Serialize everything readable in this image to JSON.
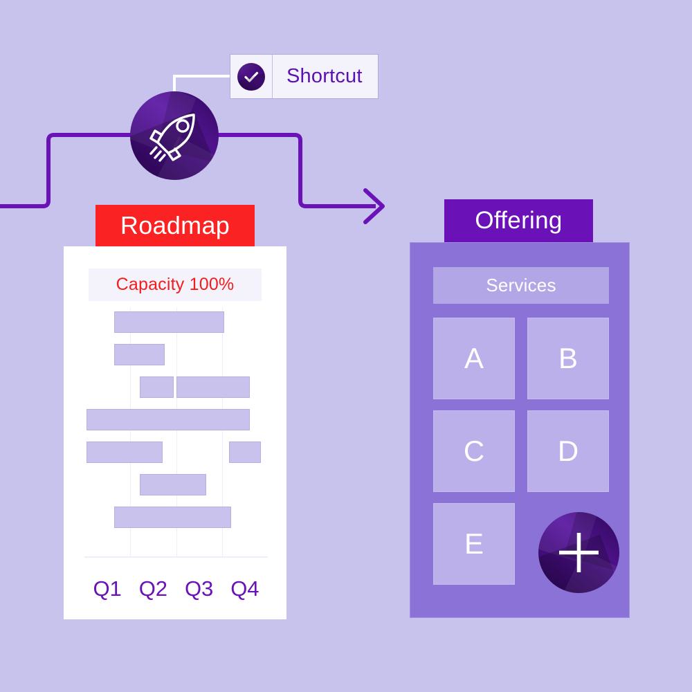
{
  "theme": {
    "background": "#c8c3ec",
    "accent_purple": "#6a11b8",
    "accent_red": "#fa2222",
    "offering_panel": "#8a72d6",
    "tile_fill": "#bcb0ea",
    "bar_fill": "#c9c2ec",
    "wire_color": "#6a11b8",
    "shortcut_wire_color": "#ffffff"
  },
  "shortcut": {
    "label": "Shortcut",
    "icon": "check-circle-icon"
  },
  "rocket_badge": {
    "icon": "rocket-icon"
  },
  "flow": {
    "arrow_icon": "arrow-right-icon"
  },
  "roadmap": {
    "title": "Roadmap",
    "capacity_label": "Capacity 100%",
    "quarters": [
      "Q1",
      "Q2",
      "Q3",
      "Q4"
    ],
    "chart_data": {
      "type": "bar",
      "title": "Roadmap",
      "xlabel": "",
      "ylabel": "",
      "grid": true,
      "legend": "none",
      "categories": [
        "Q1",
        "Q2",
        "Q3",
        "Q4"
      ],
      "xlim": [
        0,
        4
      ],
      "tasks": [
        {
          "row": 1,
          "start": 0.65,
          "end": 3.05
        },
        {
          "row": 2,
          "start": 0.65,
          "end": 1.75
        },
        {
          "row": 3,
          "start": 1.2,
          "end": 1.95
        },
        {
          "row": 3,
          "start": 2.0,
          "end": 3.6
        },
        {
          "row": 4,
          "start": 0.05,
          "end": 3.6
        },
        {
          "row": 5,
          "start": 0.05,
          "end": 1.7
        },
        {
          "row": 5,
          "start": 3.15,
          "end": 3.85
        },
        {
          "row": 6,
          "start": 1.2,
          "end": 2.65
        },
        {
          "row": 7,
          "start": 0.65,
          "end": 3.2
        }
      ]
    }
  },
  "offering": {
    "title": "Offering",
    "services_label": "Services",
    "tiles": [
      "A",
      "B",
      "C",
      "D",
      "E"
    ],
    "add_button": {
      "icon": "plus-icon",
      "label": "+"
    }
  }
}
